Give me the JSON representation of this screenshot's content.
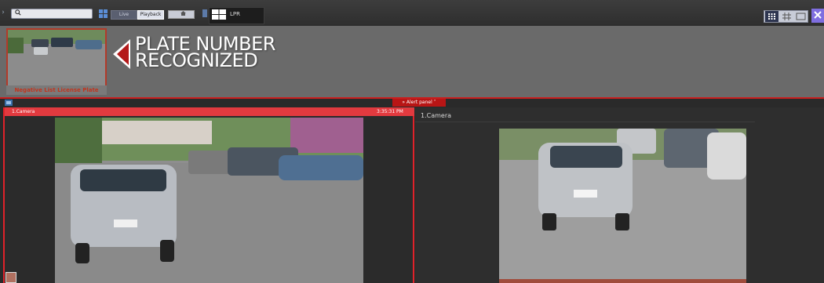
{
  "toolbar": {
    "search": {
      "value": "",
      "placeholder": ""
    },
    "live_label": "Live",
    "playback_label": "Playback",
    "tab_label": "LPR"
  },
  "alert": {
    "thumbnail_caption": "Negative List License Plate",
    "title_line1": "PLATE NUMBER",
    "title_line2": "RECOGNIZED"
  },
  "alert_panel": {
    "label": "Alert panel"
  },
  "cameras": [
    {
      "title": "1.Camera",
      "time": "3:35:31 PM"
    },
    {
      "title": "1.Camera"
    }
  ],
  "colors": {
    "alert_red": "#e0222a",
    "caption_red": "#c1351f",
    "toolbar_accent": "#7f6ee0"
  }
}
